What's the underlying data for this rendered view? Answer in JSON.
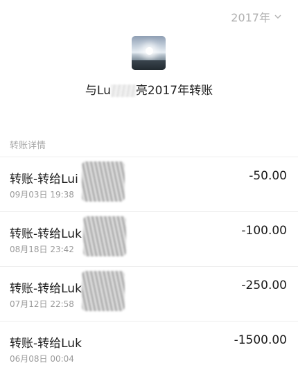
{
  "header": {
    "year": "2017年"
  },
  "profile": {
    "title_prefix": "与Lu",
    "title_suffix": "亮2017年转账"
  },
  "section": {
    "label": "转账详情"
  },
  "transactions": [
    {
      "desc": "转账-转给Lui",
      "date": "09月03日 19:38",
      "amount": "-50.00"
    },
    {
      "desc": "转账-转给Luk",
      "date": "08月18日 23:42",
      "amount": "-100.00"
    },
    {
      "desc": "转账-转给Luk",
      "date": "07月12日 22:58",
      "amount": "-250.00"
    },
    {
      "desc": "转账-转给Luk",
      "date": "06月08日 00:04",
      "amount": "-1500.00"
    }
  ]
}
